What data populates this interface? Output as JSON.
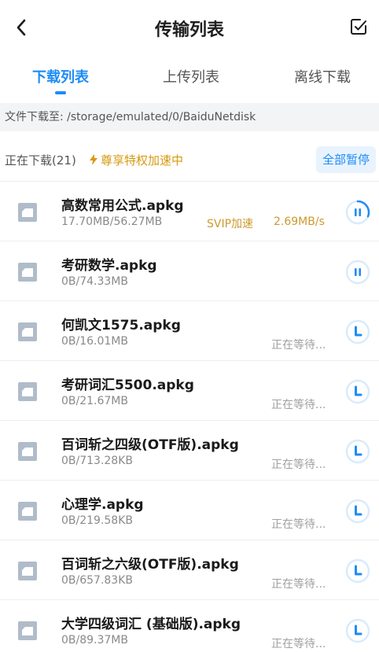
{
  "header": {
    "title": "传输列表"
  },
  "tabs": [
    {
      "label": "下载列表",
      "active": true
    },
    {
      "label": "上传列表",
      "active": false
    },
    {
      "label": "离线下载",
      "active": false
    }
  ],
  "path_bar": {
    "text": "文件下载至: /storage/emulated/0/BaiduNetdisk"
  },
  "status": {
    "downloading_label": "正在下载(21)",
    "vip_tag": "尊享特权加速中",
    "pause_all": "全部暂停"
  },
  "colors": {
    "accent": "#1e8cf5",
    "vip": "#cc9a2d",
    "icon_gray": "#b0bcc9"
  },
  "files": [
    {
      "name": "高数常用公式.apkg",
      "size": "17.70MB/56.27MB",
      "svip": "SVIP加速",
      "speed": "2.69MB/s",
      "waiting": "",
      "state": "downloading",
      "progress": 0.31
    },
    {
      "name": "考研数学.apkg",
      "size": "0B/74.33MB",
      "svip": "",
      "speed": "",
      "waiting": "",
      "state": "paused"
    },
    {
      "name": "何凯文1575.apkg",
      "size": "0B/16.01MB",
      "svip": "",
      "speed": "",
      "waiting": "正在等待...",
      "state": "waiting"
    },
    {
      "name": "考研词汇5500.apkg",
      "size": "0B/21.67MB",
      "svip": "",
      "speed": "",
      "waiting": "正在等待...",
      "state": "waiting"
    },
    {
      "name": "百词斩之四级(OTF版).apkg",
      "size": "0B/713.28KB",
      "svip": "",
      "speed": "",
      "waiting": "正在等待...",
      "state": "waiting"
    },
    {
      "name": "心理学.apkg",
      "size": "0B/219.58KB",
      "svip": "",
      "speed": "",
      "waiting": "正在等待...",
      "state": "waiting"
    },
    {
      "name": "百词斩之六级(OTF版).apkg",
      "size": "0B/657.83KB",
      "svip": "",
      "speed": "",
      "waiting": "正在等待...",
      "state": "waiting"
    },
    {
      "name": "大学四级词汇 (基础版).apkg",
      "size": "0B/89.37MB",
      "svip": "",
      "speed": "",
      "waiting": "正在等待...",
      "state": "waiting"
    }
  ]
}
